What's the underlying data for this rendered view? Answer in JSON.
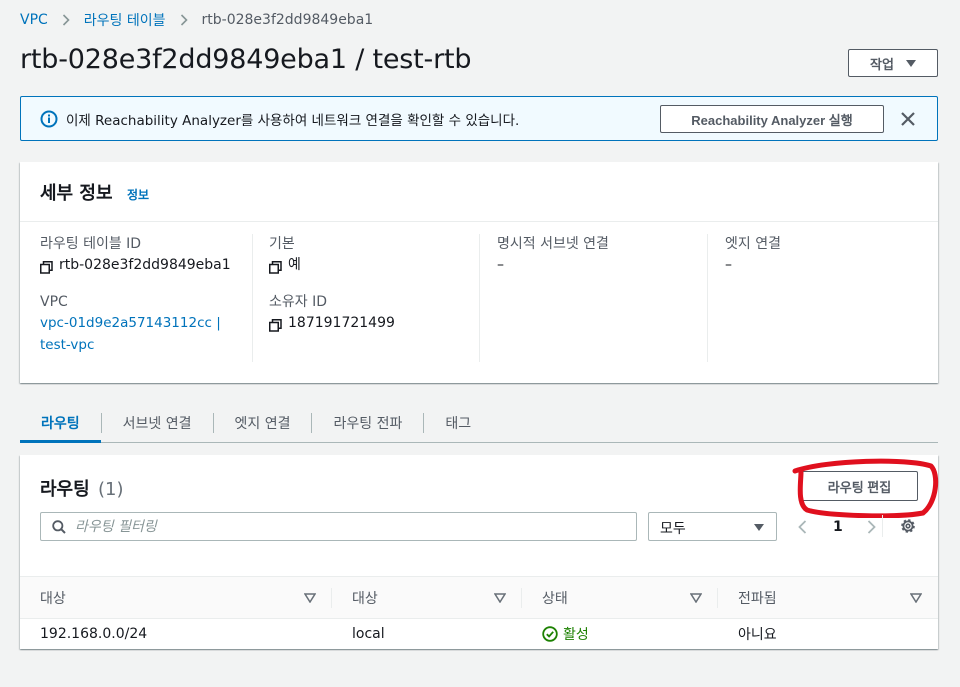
{
  "breadcrumb": {
    "vpc": "VPC",
    "route_tables": "라우팅 테이블",
    "current": "rtb-028e3f2dd9849eba1"
  },
  "header": {
    "title": "rtb-028e3f2dd9849eba1 / test-rtb",
    "actions_label": "작업"
  },
  "flash": {
    "text": "이제 Reachability Analyzer를 사용하여 네트워크 연결을 확인할 수 있습니다.",
    "button_label": "Reachability Analyzer 실행"
  },
  "details": {
    "title": "세부 정보",
    "info_link": "정보",
    "route_table_id_label": "라우팅 테이블 ID",
    "route_table_id": "rtb-028e3f2dd9849eba1",
    "main_label": "기본",
    "main_value": "예",
    "explicit_subnet_label": "명시적 서브넷 연결",
    "explicit_subnet_value": "–",
    "edge_label": "엣지 연결",
    "edge_value": "–",
    "vpc_label": "VPC",
    "vpc_value_line1": "vpc-01d9e2a57143112cc |",
    "vpc_value_line2": "test-vpc",
    "owner_label": "소유자 ID",
    "owner_value": "187191721499"
  },
  "tabs": [
    "라우팅",
    "서브넷 연결",
    "엣지 연결",
    "라우팅 전파",
    "태그"
  ],
  "routes": {
    "title": "라우팅",
    "count": "(1)",
    "edit_button": "라우팅 편집",
    "filter_placeholder": "라우팅 필터링",
    "select_value": "모두",
    "page": "1",
    "columns": [
      "대상",
      "대상",
      "상태",
      "전파됨"
    ],
    "rows": [
      {
        "destination": "192.168.0.0/24",
        "target": "local",
        "status": "활성",
        "propagated": "아니요"
      }
    ]
  },
  "colors": {
    "link": "#0073bb",
    "status_active": "#1d8102",
    "annotation": "#e0101e"
  },
  "icons": [
    "chevron-right-icon",
    "info-icon",
    "close-icon",
    "copy-icon",
    "search-icon",
    "caret-down-icon",
    "chevron-left-icon",
    "gear-icon",
    "sort-icon",
    "check-circle-icon"
  ]
}
